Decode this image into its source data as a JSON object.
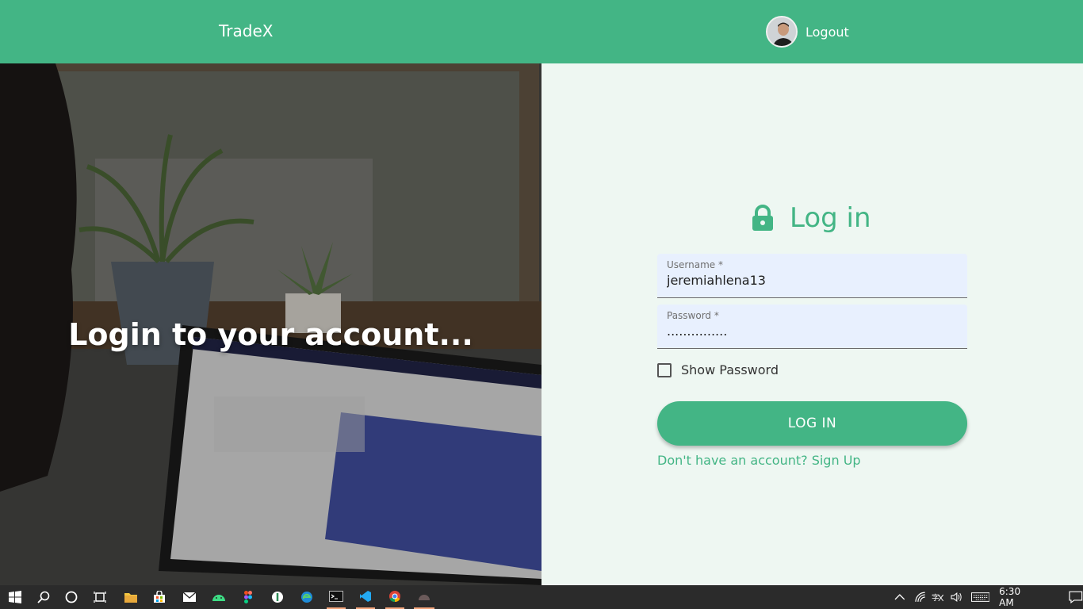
{
  "header": {
    "brand": "TradeX",
    "logout_label": "Logout"
  },
  "hero": {
    "title": "Login to your account..."
  },
  "login": {
    "title": "Log in",
    "username_label": "Username *",
    "username_value": "jeremiahlena13",
    "password_label": "Password *",
    "password_value": "...............",
    "show_password_label": "Show Password",
    "button_label": "LOG IN",
    "signup_link": "Don't have an account? Sign Up"
  },
  "taskbar": {
    "icons": [
      "windows-start-icon",
      "search-icon",
      "cortana-icon",
      "task-view-icon",
      "file-explorer-icon",
      "store-icon",
      "mail-icon",
      "android-studio-icon",
      "figma-icon",
      "app-icon",
      "edge-icon",
      "terminal-icon",
      "vscode-icon",
      "chrome-icon",
      "app2-icon"
    ],
    "time": "6:30 AM"
  },
  "colors": {
    "accent": "#43b585",
    "field_bg": "#e8f0fe",
    "panel_bg": "#eef7f2",
    "taskbar": "#2b2b2b"
  }
}
